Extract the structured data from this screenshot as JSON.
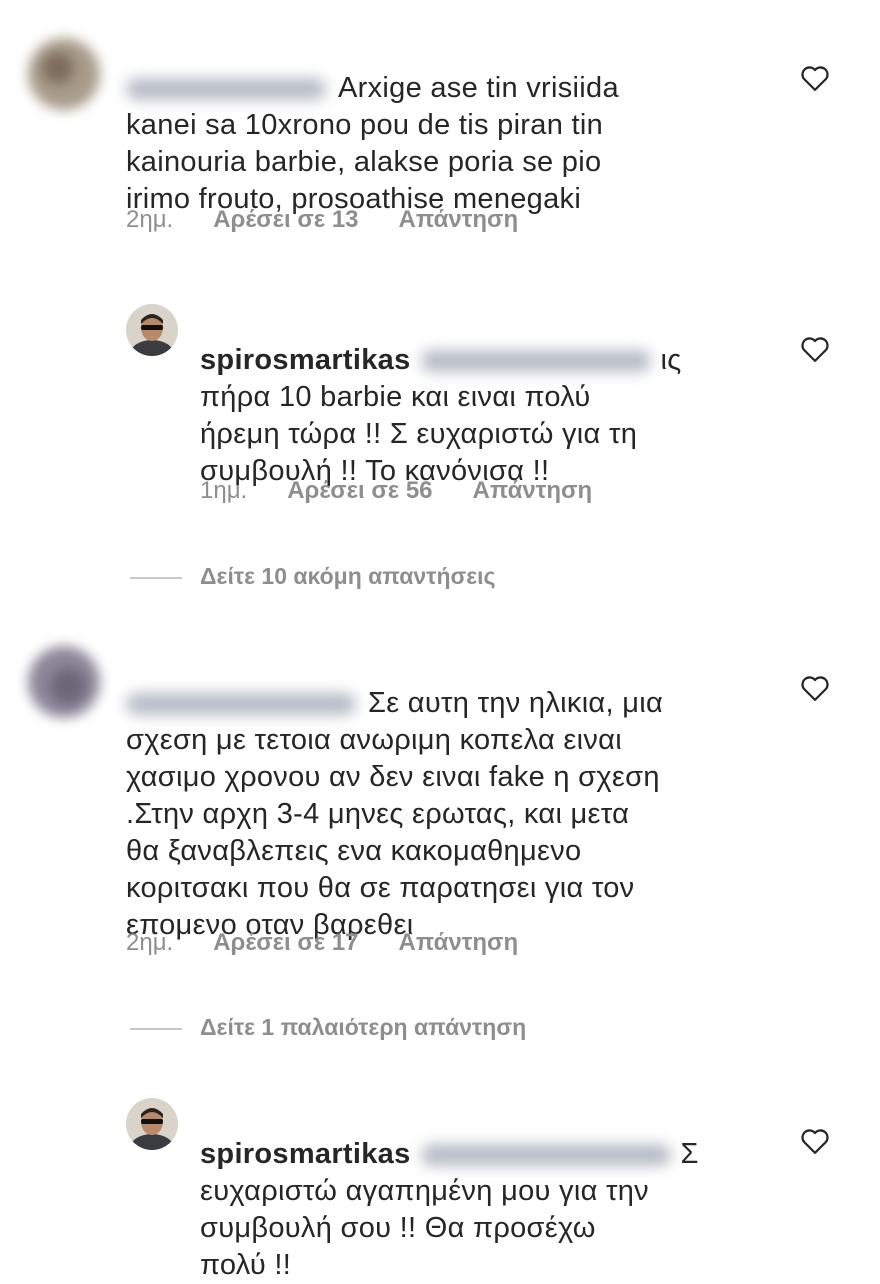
{
  "comments": [
    {
      "type": "comment",
      "username": "",
      "text": "Arxige ase tin vrisiida\nkanei sa 10xrono pou de tis piran tin\nkainouria barbie, alakse poria se pio\nirimo frouto, prosoathise menegaki",
      "time": "2ημ.",
      "likes": "Αρέσει σε 13",
      "reply": "Απάντηση"
    },
    {
      "type": "reply",
      "username": "spirosmartikas",
      "text": "ις\nπήρα 10 barbie και ειναι πολύ\nήρεμη τώρα !! Σ ευχαριστώ για τη\nσυμβουλή !! Το κανόνισα !!",
      "time": "1ημ.",
      "likes": "Αρέσει σε 56",
      "reply": "Απάντηση"
    },
    {
      "type": "comment",
      "username": "",
      "text": "Σε αυτη την ηλικια, μια\nσχεση με τετοια  ανωριμη κοπελα ειναι\nχασιμο χρονου αν δεν ειναι fake η σχεση\n.Στην αρχη 3-4 μηνες ερωτας, και μετα\nθα ξαναβλεπεις ενα κακομαθημενο\nκοριτσακι που θα σε παρατησει για τον\nεπομενο οταν βαρεθει",
      "time": "2ημ.",
      "likes": "Αρέσει σε 17",
      "reply": "Απάντηση"
    },
    {
      "type": "reply",
      "username": "spirosmartikas",
      "text": "Σ\nευχαριστώ αγαπημένη μου για την\nσυμβουλή σου !! Θα προσέχω\nπολύ !!",
      "time": "",
      "likes": "",
      "reply": ""
    }
  ],
  "view_more": [
    "Δείτε 10 ακόμη απαντήσεις",
    "Δείτε 1 παλαιότερη απάντηση"
  ],
  "colors": {
    "text": "#262626",
    "meta": "#8e8e8e",
    "divider": "#c7c7c7"
  },
  "icons": {
    "like": "heart-outline-icon"
  }
}
